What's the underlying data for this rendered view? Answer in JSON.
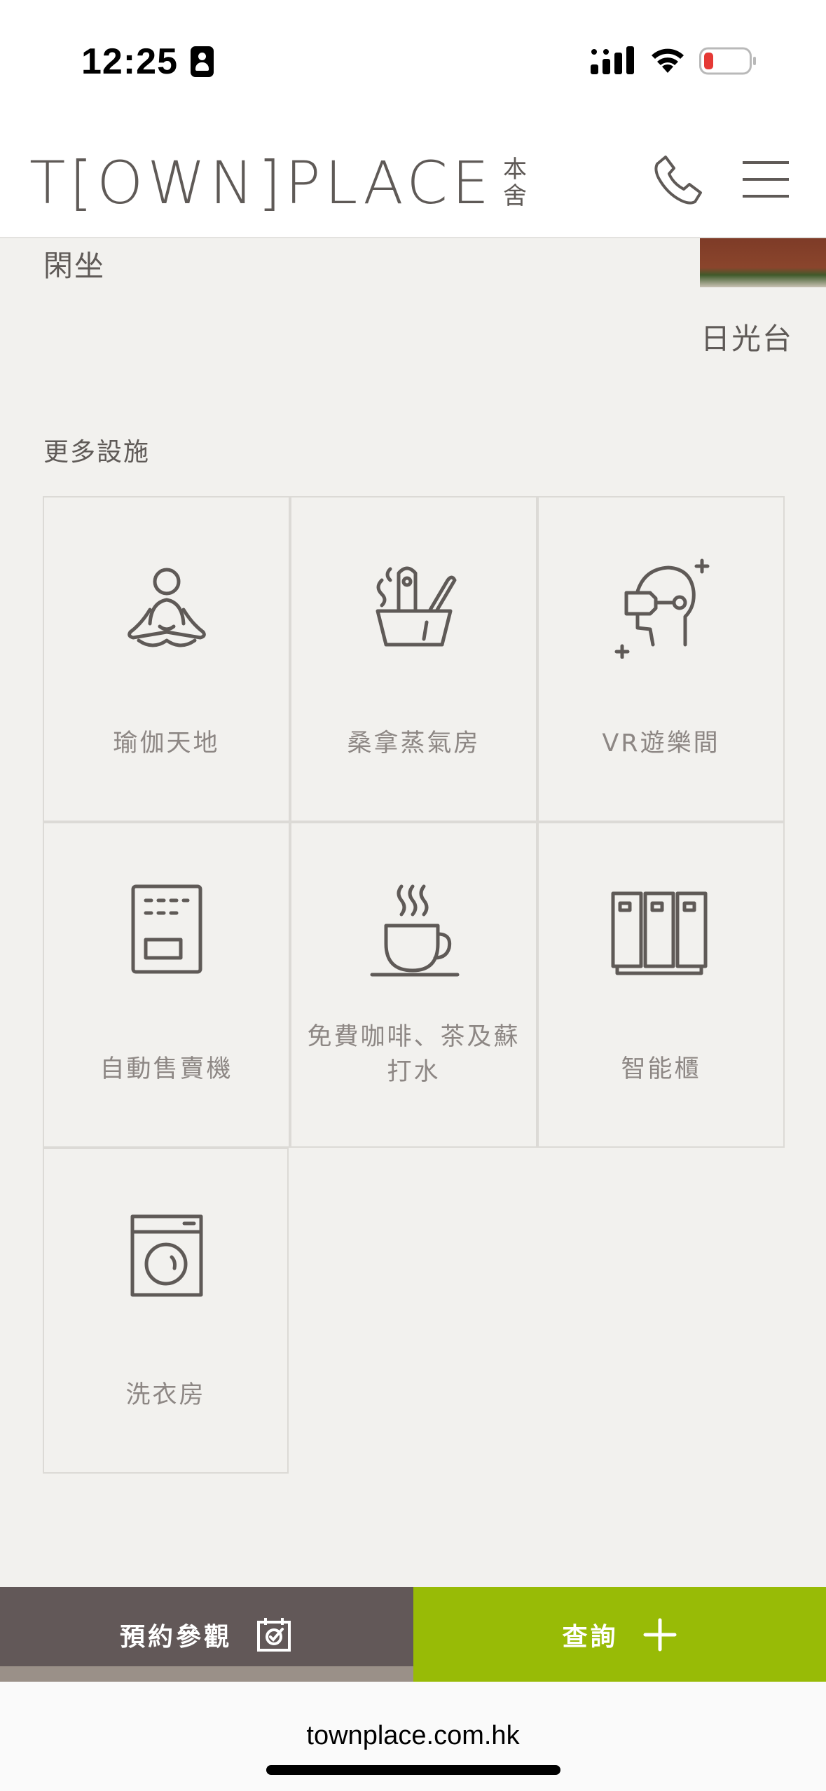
{
  "status_bar": {
    "time": "12:25",
    "icons": [
      "focus-icon",
      "cellular-signal-icon",
      "wifi-icon",
      "battery-icon"
    ],
    "battery_color": "#e53935"
  },
  "header": {
    "logo_text": "T[OWN]PLACE",
    "logo_cn_top": "本",
    "logo_cn_bottom": "舍",
    "icons": [
      "phone-icon",
      "hamburger-menu-icon"
    ]
  },
  "content": {
    "leisure_label": "閑坐",
    "sun_label": "日光台",
    "more_facilities_title": "更多設施",
    "facilities": [
      {
        "label": "瑜伽天地",
        "icon": "yoga-icon"
      },
      {
        "label": "桑拿蒸氣房",
        "icon": "sauna-icon"
      },
      {
        "label": "VR遊樂間",
        "icon": "vr-headset-icon"
      },
      {
        "label": "自動售賣機",
        "icon": "vending-machine-icon"
      },
      {
        "label": "免費咖啡、茶及蘇打水",
        "icon": "coffee-cup-icon"
      },
      {
        "label": "智能櫃",
        "icon": "smart-locker-icon"
      },
      {
        "label": "洗衣房",
        "icon": "washing-machine-icon"
      }
    ]
  },
  "cta": {
    "visit_label": "預約參觀",
    "query_label": "查詢",
    "visit_color": "#625858",
    "query_color": "#98bb06"
  },
  "browser": {
    "url": "townplace.com.hk"
  }
}
